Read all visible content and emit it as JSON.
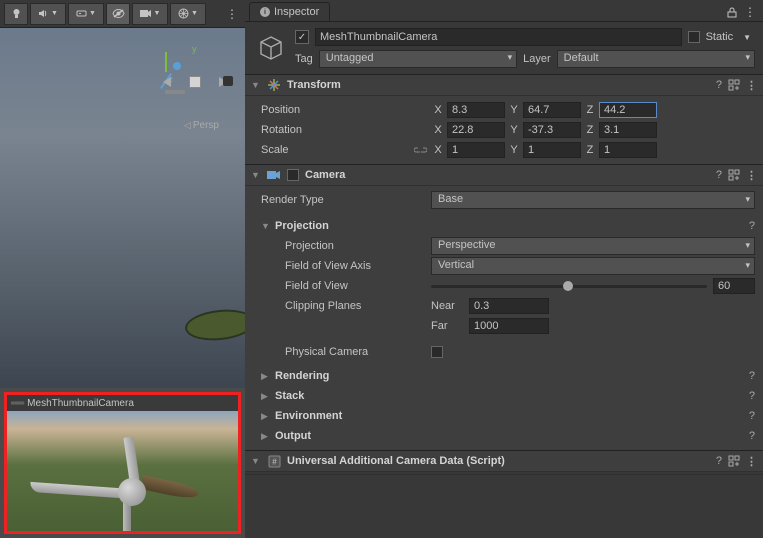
{
  "inspector": {
    "tab_label": "Inspector",
    "object_name": "MeshThumbnailCamera",
    "active_checked": "✓",
    "static_label": "Static",
    "tag_label": "Tag",
    "tag_value": "Untagged",
    "layer_label": "Layer",
    "layer_value": "Default"
  },
  "transform": {
    "title": "Transform",
    "position_label": "Position",
    "rotation_label": "Rotation",
    "scale_label": "Scale",
    "pos": {
      "x": "8.3",
      "y": "64.7",
      "z": "44.2"
    },
    "rot": {
      "x": "22.8",
      "y": "-37.3",
      "z": "3.1"
    },
    "scale": {
      "x": "1",
      "y": "1",
      "z": "1"
    },
    "axis_x": "X",
    "axis_y": "Y",
    "axis_z": "Z"
  },
  "camera": {
    "title": "Camera",
    "render_type_label": "Render Type",
    "render_type_value": "Base",
    "projection_section": "Projection",
    "projection_label": "Projection",
    "projection_value": "Perspective",
    "fov_axis_label": "Field of View Axis",
    "fov_axis_value": "Vertical",
    "fov_label": "Field of View",
    "fov_value": "60",
    "clipping_label": "Clipping Planes",
    "near_label": "Near",
    "near_value": "0.3",
    "far_label": "Far",
    "far_value": "1000",
    "physical_label": "Physical Camera",
    "rendering_section": "Rendering",
    "stack_section": "Stack",
    "environment_section": "Environment",
    "output_section": "Output"
  },
  "urp": {
    "title": "Universal Additional Camera Data (Script)"
  },
  "scene": {
    "persp_label": "Persp",
    "preview_title": "MeshThumbnailCamera"
  }
}
